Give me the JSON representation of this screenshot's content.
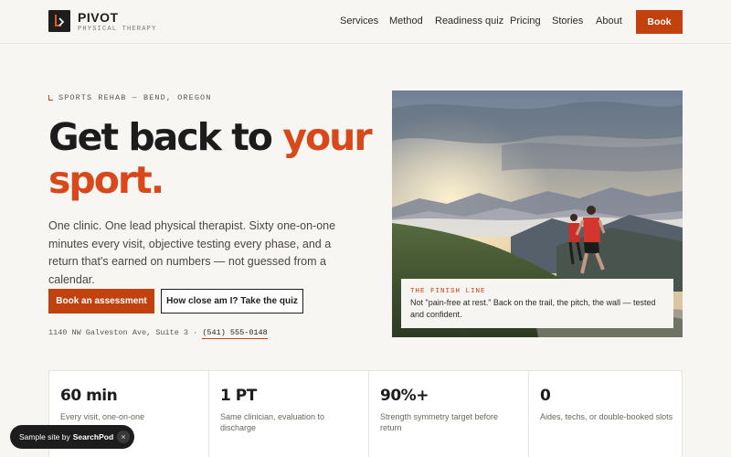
{
  "brand": {
    "name": "PIVOT",
    "tagline": "PHYSICAL THERAPY"
  },
  "nav": {
    "items": [
      "Services",
      "Method",
      "Readiness quiz",
      "Pricing",
      "Stories",
      "About"
    ],
    "cta": "Book"
  },
  "hero": {
    "eyebrow": "SPORTS REHAB — BEND, OREGON",
    "headline_part1": "Get back to ",
    "headline_accent": "your sport.",
    "lead": "One clinic. One lead physical therapist. Sixty one-on-one minutes every visit, objective testing every phase, and a return that's earned on numbers — not guessed from a calendar.",
    "primary_cta": "Book an assessment",
    "secondary_cta": "How close am I? Take the quiz",
    "address": "1140 NW Galveston Ave, Suite 3 · ",
    "phone": "(541) 555-0148"
  },
  "image_caption": {
    "kicker": "THE FINISH LINE",
    "text": "Not \"pain-free at rest.\" Back on the trail, the pitch, the wall — tested and confident."
  },
  "stats": [
    {
      "value": "60 min",
      "label": "Every visit, one-on-one"
    },
    {
      "value": "1 PT",
      "label": "Same clinician, evaluation to discharge"
    },
    {
      "value": "90%+",
      "label": "Strength symmetry target before return"
    },
    {
      "value": "0",
      "label": "Aides, techs, or double-booked slots"
    }
  ],
  "toast": {
    "prefix": "Sample site by",
    "brand": "SearchPod",
    "close": "×"
  },
  "colors": {
    "accent": "#c1410f",
    "headline_accent": "#d9481a",
    "background": "#f8f6f3",
    "ink": "#1c1c1c"
  },
  "icons": {
    "logo": "pivot-arrow-icon",
    "toast_close": "close-icon"
  }
}
